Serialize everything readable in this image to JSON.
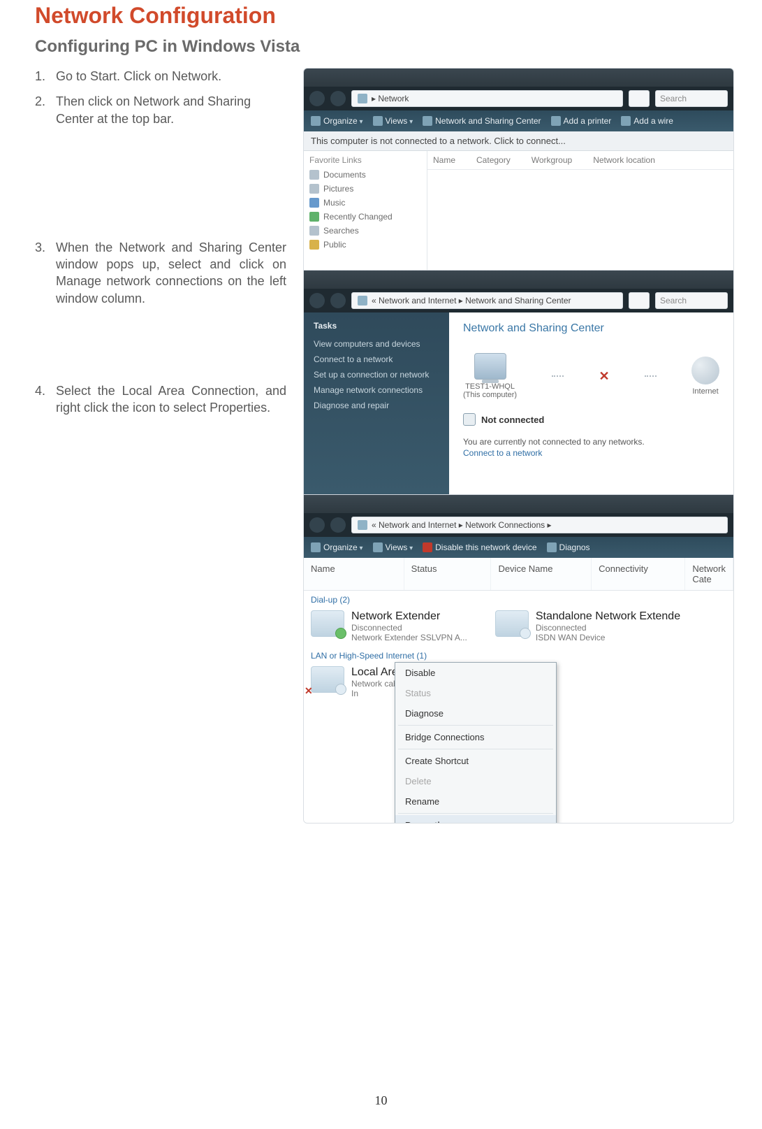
{
  "heading": "Network Configuration",
  "subheading": "Configuring PC in Windows Vista",
  "page_number": "10",
  "steps": [
    {
      "num": "1.",
      "text": "Go to Start. Click on Network."
    },
    {
      "num": "2.",
      "text": "Then click on Network and Sharing Center at the top bar."
    },
    {
      "num": "3.",
      "text": "When the Network and Sharing Center window pops up, select and click on Manage network connections on the left window column."
    },
    {
      "num": "4.",
      "text": "Select the Local Area Connection, and right click the icon to select Properties."
    }
  ],
  "panel1": {
    "address_path": "▸ Network",
    "search_placeholder": "Search",
    "cmdbar": {
      "organize": "Organize",
      "views": "Views",
      "nsc": "Network and Sharing Center",
      "add_printer": "Add a printer",
      "add_wireless": "Add a wire"
    },
    "infobar": "This computer is not connected to a network. Click to connect...",
    "fav_header": "Favorite Links",
    "fav_items": [
      "Documents",
      "Pictures",
      "Music",
      "Recently Changed",
      "Searches",
      "Public"
    ],
    "cols": [
      "Name",
      "Category",
      "Workgroup",
      "Network location"
    ]
  },
  "panel2": {
    "address_path": "« Network and Internet ▸ Network and Sharing Center",
    "search_placeholder": "Search",
    "tasks_header": "Tasks",
    "tasks": [
      "View computers and devices",
      "Connect to a network",
      "Set up a connection or network",
      "Manage network connections",
      "Diagnose and repair"
    ],
    "nsc_title": "Network and Sharing Center",
    "node_pc_name": "TEST1-WHQL",
    "node_pc_sub": "(This computer)",
    "node_internet": "Internet",
    "not_connected": "Not connected",
    "msg": "You are currently not connected to any networks.",
    "connect_link": "Connect to a network"
  },
  "panel3": {
    "address_path": "« Network and Internet ▸ Network Connections ▸",
    "cmdbar": {
      "organize": "Organize",
      "views": "Views",
      "disable": "Disable this network device",
      "diagnose": "Diagnos"
    },
    "cols": [
      "Name",
      "Status",
      "Device Name",
      "Connectivity",
      "Network Cate"
    ],
    "group_dialup": "Dial-up (2)",
    "group_lan": "LAN or High-Speed Internet (1)",
    "conn_ext": {
      "name": "Network Extender",
      "status": "Disconnected",
      "device": "Network Extender SSLVPN A..."
    },
    "conn_isdn": {
      "name": "Standalone Network Extende",
      "status": "Disconnected",
      "device": "ISDN WAN Device"
    },
    "conn_lan": {
      "name": "Local Area Connection",
      "status": "Network cable unplugged",
      "device": "In"
    },
    "ctx_items": [
      {
        "label": "Disable",
        "disabled": false
      },
      {
        "label": "Status",
        "disabled": true
      },
      {
        "label": "Diagnose",
        "disabled": false
      },
      {
        "sep": true
      },
      {
        "label": "Bridge Connections",
        "disabled": false
      },
      {
        "sep": true
      },
      {
        "label": "Create Shortcut",
        "disabled": false
      },
      {
        "label": "Delete",
        "disabled": true
      },
      {
        "label": "Rename",
        "disabled": false
      },
      {
        "sep": true
      },
      {
        "label": "Properties",
        "disabled": false,
        "selected": true
      }
    ]
  }
}
